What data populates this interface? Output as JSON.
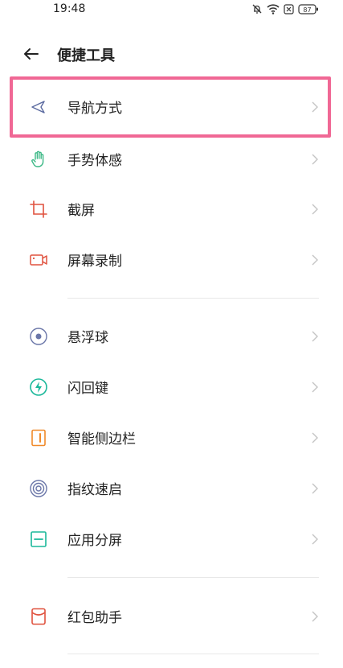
{
  "status": {
    "time": "19:48",
    "battery": "87"
  },
  "header": {
    "title": "便捷工具"
  },
  "items": [
    {
      "label": "导航方式"
    },
    {
      "label": "手势体感"
    },
    {
      "label": "截屏"
    },
    {
      "label": "屏幕录制"
    },
    {
      "label": "悬浮球"
    },
    {
      "label": "闪回键"
    },
    {
      "label": "智能侧边栏"
    },
    {
      "label": "指纹速启"
    },
    {
      "label": "应用分屏"
    },
    {
      "label": "红包助手"
    }
  ],
  "colors": {
    "highlight": "#f06895",
    "green": "#3cb886",
    "red": "#e0523f",
    "orange": "#f08a2a",
    "indigo": "#6a76a8"
  }
}
